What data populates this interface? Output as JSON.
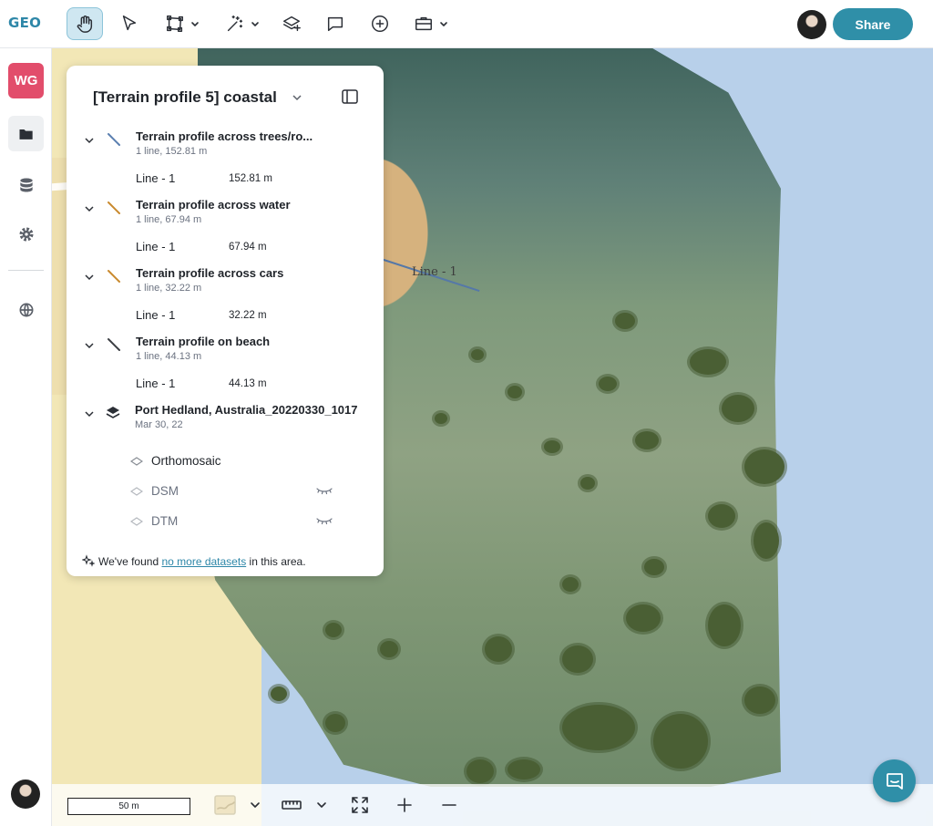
{
  "app": {
    "logo": "GEO"
  },
  "toolbar": {
    "tools": [
      "pan-tool",
      "select-tool",
      "polygon-tool",
      "magic-wand-tool",
      "add-layer-tool",
      "comment-tool",
      "add-point-tool",
      "toolbox-tool"
    ],
    "active_tool": "pan-tool",
    "share_label": "Share"
  },
  "sidebar": {
    "workspace_badge": "WG",
    "items": [
      "folder-icon",
      "database-icon",
      "settings-icon",
      "globe-icon"
    ]
  },
  "panel": {
    "title": "[Terrain profile 5] coastal",
    "layers": [
      {
        "name": "Terrain profile across trees/ro...",
        "meta": "1 line, 152.81 m",
        "sub_label": "Line - 1",
        "sub_value": "152.81 m",
        "color": "#5b7fb0"
      },
      {
        "name": "Terrain profile across water",
        "meta": "1 line, 67.94 m",
        "sub_label": "Line - 1",
        "sub_value": "67.94 m",
        "color": "#c98a2e"
      },
      {
        "name": "Terrain profile across cars",
        "meta": "1 line, 32.22 m",
        "sub_label": "Line - 1",
        "sub_value": "32.22 m",
        "color": "#c98a2e"
      },
      {
        "name": "Terrain profile on beach",
        "meta": "1 line, 44.13 m",
        "sub_label": "Line - 1",
        "sub_value": "44.13 m",
        "color": "#3c3f44"
      }
    ],
    "dataset": {
      "name": "Port Hedland, Australia_20220330_1017",
      "date": "Mar 30, 22",
      "items": [
        {
          "label": "Orthomosaic",
          "hidden": false
        },
        {
          "label": "DSM",
          "hidden": true
        },
        {
          "label": "DTM",
          "hidden": true
        }
      ]
    },
    "found_prefix": "We've found",
    "found_link": "no more datasets",
    "found_suffix": "in this area."
  },
  "map": {
    "label": "Line - 1"
  },
  "bottombar": {
    "scale_label": "50 m"
  }
}
